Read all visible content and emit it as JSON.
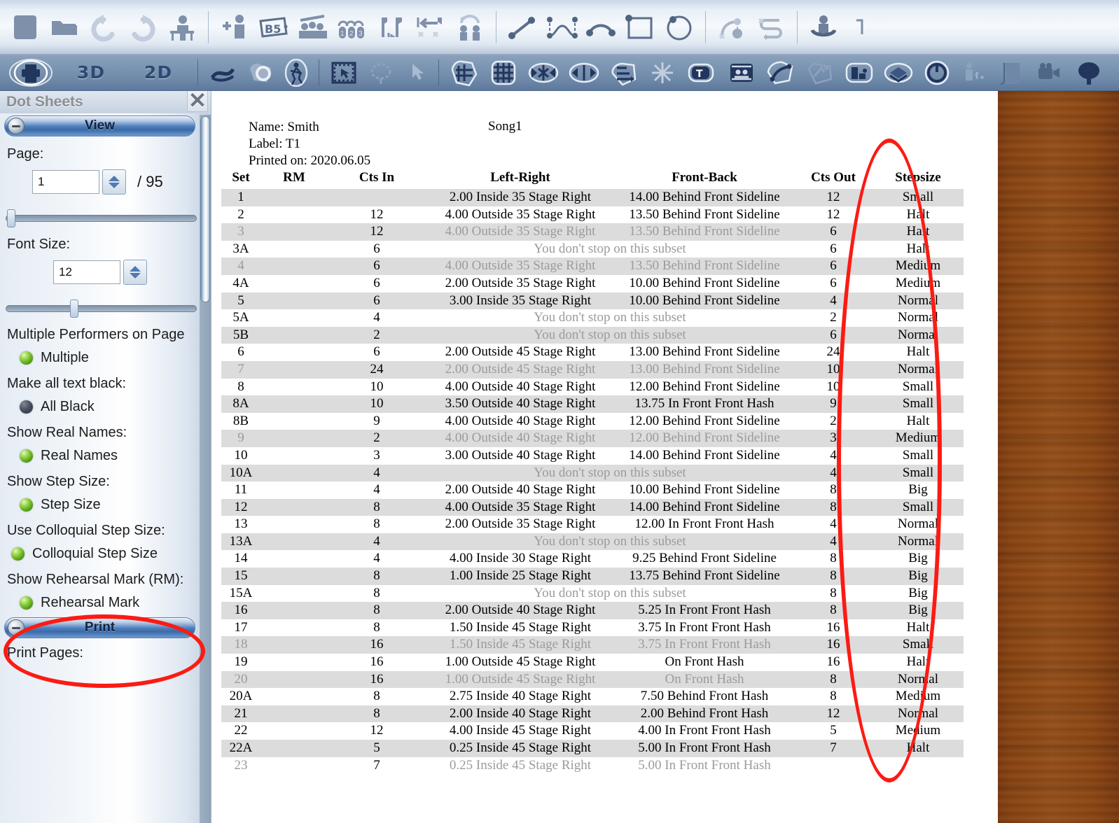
{
  "toolbar_top": {
    "buttons": [
      {
        "name": "new-file-icon",
        "label": "New"
      },
      {
        "name": "open-folder-icon",
        "label": "Open"
      },
      {
        "name": "undo-icon",
        "label": "Undo"
      },
      {
        "name": "redo-icon",
        "label": "Redo"
      },
      {
        "name": "performer-at-desk-icon",
        "label": "Performers"
      },
      {
        "name": "add-performer-icon",
        "label": "Add Performer"
      },
      {
        "name": "b5-label-icon",
        "label": "B5"
      },
      {
        "name": "group-performers-icon",
        "label": "Group"
      },
      {
        "name": "numbered-performers-icon",
        "label": "Number Performers"
      },
      {
        "name": "flags-icon",
        "label": "Flags"
      },
      {
        "name": "align-left-icon",
        "label": "Align"
      },
      {
        "name": "mirror-performers-icon",
        "label": "Mirror"
      },
      {
        "name": "line-tool-icon",
        "label": "Line"
      },
      {
        "name": "curve-points-icon",
        "label": "Curve Points"
      },
      {
        "name": "arc-tool-icon",
        "label": "Arc"
      },
      {
        "name": "rectangle-tool-icon",
        "label": "Rectangle"
      },
      {
        "name": "circle-tool-icon",
        "label": "Circle"
      },
      {
        "name": "follow-path-icon",
        "label": "Follow Path"
      },
      {
        "name": "s-path-icon",
        "label": "S Path"
      },
      {
        "name": "rotate-performer-icon",
        "label": "Rotate"
      }
    ]
  },
  "toolbar_sub": {
    "print_icon": "print-icon",
    "view_3d": "3D",
    "view_2d": "2D",
    "buttons": [
      {
        "name": "curve-draw-icon",
        "label": "Draw Curve"
      },
      {
        "name": "shape-fill-icon",
        "label": "Shape"
      },
      {
        "name": "walking-performer-icon",
        "label": "Walking"
      },
      {
        "name": "marquee-select-icon",
        "label": "Marquee Select"
      },
      {
        "name": "lasso-select-icon",
        "label": "Lasso Select"
      },
      {
        "name": "pointer-select-icon",
        "label": "Pointer"
      },
      {
        "name": "freeform-grid-icon",
        "label": "Freeform Grid"
      },
      {
        "name": "grid-icon",
        "label": "Grid"
      },
      {
        "name": "contract-horizontal-icon",
        "label": "Contract"
      },
      {
        "name": "expand-horizontal-icon",
        "label": "Expand"
      },
      {
        "name": "stagger-icon",
        "label": "Stagger"
      },
      {
        "name": "scatter-icon",
        "label": "Scatter"
      },
      {
        "name": "text-tag-icon",
        "label": "Text Tag"
      },
      {
        "name": "bleachers-icon",
        "label": "Bleachers"
      },
      {
        "name": "curved-path-icon",
        "label": "Curved Path"
      },
      {
        "name": "flip-icon",
        "label": "Flip"
      },
      {
        "name": "field-layer-icon",
        "label": "Field Layer"
      },
      {
        "name": "power-icon",
        "label": "Power"
      },
      {
        "name": "props-icon",
        "label": "Props"
      },
      {
        "name": "page-icon",
        "label": "Page"
      },
      {
        "name": "video-camera-icon",
        "label": "Video"
      },
      {
        "name": "tree-icon",
        "label": "Tree"
      }
    ]
  },
  "panel": {
    "title": "Dot Sheets",
    "close_icon": "close-icon",
    "sections": {
      "view": {
        "label": "View",
        "collapse_icon": "collapse-icon"
      },
      "print": {
        "label": "Print",
        "collapse_icon": "collapse-icon"
      }
    },
    "page": {
      "label": "Page:",
      "value": "1",
      "total": "/ 95",
      "spinner_up_icon": "spinner-up-icon",
      "spinner_down_icon": "spinner-down-icon"
    },
    "font_size": {
      "label": "Font Size:",
      "value": "12",
      "spinner_up_icon": "spinner-up-icon",
      "spinner_down_icon": "spinner-down-icon"
    },
    "options": [
      {
        "label": "Multiple Performers on Page",
        "toggle": "Multiple",
        "state": "on"
      },
      {
        "label": "Make all text black:",
        "toggle": "All Black",
        "state": "off"
      },
      {
        "label": "Show Real Names:",
        "toggle": "Real Names",
        "state": "on"
      },
      {
        "label": "Show Step Size:",
        "toggle": "Step Size",
        "state": "on"
      },
      {
        "label": "Use Colloquial Step Size:",
        "toggle": "Colloquial Step Size",
        "state": "on"
      },
      {
        "label": "Show Rehearsal Mark (RM):",
        "toggle": "Rehearsal Mark",
        "state": "on"
      }
    ],
    "print_pages_label": "Print Pages:"
  },
  "document": {
    "name_line": "Name: Smith",
    "label_line": "Label: T1",
    "printed_line": "Printed on: 2020.06.05",
    "song": "Song1",
    "columns": [
      "Set",
      "RM",
      "Cts In",
      "Left-Right",
      "Front-Back",
      "Cts Out",
      "Stepsize"
    ],
    "rows": [
      {
        "set": "1",
        "rm": "",
        "cts_in": "",
        "lr": "2.00 Inside 35 Stage Right",
        "fb": "14.00 Behind Front Sideline",
        "cts_out": "12",
        "ss": "Small",
        "alt": true,
        "dim": false
      },
      {
        "set": "2",
        "rm": "",
        "cts_in": "12",
        "lr": "4.00 Outside 35 Stage Right",
        "fb": "13.50 Behind Front Sideline",
        "cts_out": "12",
        "ss": "Halt",
        "alt": false,
        "dim": false
      },
      {
        "set": "3",
        "rm": "",
        "cts_in": "12",
        "lr": "4.00 Outside 35 Stage Right",
        "fb": "13.50 Behind Front Sideline",
        "cts_out": "6",
        "ss": "Halt",
        "alt": true,
        "dim": true
      },
      {
        "set": "3A",
        "rm": "",
        "cts_in": "6",
        "lr": "You don't stop on this subset",
        "fb": "",
        "cts_out": "6",
        "ss": "Halt",
        "alt": false,
        "dim": false,
        "subset": true
      },
      {
        "set": "4",
        "rm": "",
        "cts_in": "6",
        "lr": "4.00 Outside 35 Stage Right",
        "fb": "13.50 Behind Front Sideline",
        "cts_out": "6",
        "ss": "Medium",
        "alt": true,
        "dim": true
      },
      {
        "set": "4A",
        "rm": "",
        "cts_in": "6",
        "lr": "2.00 Outside 35 Stage Right",
        "fb": "10.00 Behind Front Sideline",
        "cts_out": "6",
        "ss": "Medium",
        "alt": false,
        "dim": false
      },
      {
        "set": "5",
        "rm": "",
        "cts_in": "6",
        "lr": "3.00 Inside 35 Stage Right",
        "fb": "10.00 Behind Front Sideline",
        "cts_out": "4",
        "ss": "Normal",
        "alt": true,
        "dim": false
      },
      {
        "set": "5A",
        "rm": "",
        "cts_in": "4",
        "lr": "You don't stop on this subset",
        "fb": "",
        "cts_out": "2",
        "ss": "Normal",
        "alt": false,
        "dim": false,
        "subset": true
      },
      {
        "set": "5B",
        "rm": "",
        "cts_in": "2",
        "lr": "You don't stop on this subset",
        "fb": "",
        "cts_out": "6",
        "ss": "Normal",
        "alt": true,
        "dim": false,
        "subset": true
      },
      {
        "set": "6",
        "rm": "",
        "cts_in": "6",
        "lr": "2.00 Outside 45 Stage Right",
        "fb": "13.00 Behind Front Sideline",
        "cts_out": "24",
        "ss": "Halt",
        "alt": false,
        "dim": false
      },
      {
        "set": "7",
        "rm": "",
        "cts_in": "24",
        "lr": "2.00 Outside 45 Stage Right",
        "fb": "13.00 Behind Front Sideline",
        "cts_out": "10",
        "ss": "Normal",
        "alt": true,
        "dim": true
      },
      {
        "set": "8",
        "rm": "",
        "cts_in": "10",
        "lr": "4.00 Outside 40 Stage Right",
        "fb": "12.00 Behind Front Sideline",
        "cts_out": "10",
        "ss": "Small",
        "alt": false,
        "dim": false
      },
      {
        "set": "8A",
        "rm": "",
        "cts_in": "10",
        "lr": "3.50 Outside 40 Stage Right",
        "fb": "13.75 In Front Front Hash",
        "cts_out": "9",
        "ss": "Small",
        "alt": true,
        "dim": false
      },
      {
        "set": "8B",
        "rm": "",
        "cts_in": "9",
        "lr": "4.00 Outside 40 Stage Right",
        "fb": "12.00 Behind Front Sideline",
        "cts_out": "2",
        "ss": "Halt",
        "alt": false,
        "dim": false
      },
      {
        "set": "9",
        "rm": "",
        "cts_in": "2",
        "lr": "4.00 Outside 40 Stage Right",
        "fb": "12.00 Behind Front Sideline",
        "cts_out": "3",
        "ss": "Medium",
        "alt": true,
        "dim": true
      },
      {
        "set": "10",
        "rm": "",
        "cts_in": "3",
        "lr": "3.00 Outside 40 Stage Right",
        "fb": "14.00 Behind Front Sideline",
        "cts_out": "4",
        "ss": "Small",
        "alt": false,
        "dim": false
      },
      {
        "set": "10A",
        "rm": "",
        "cts_in": "4",
        "lr": "You don't stop on this subset",
        "fb": "",
        "cts_out": "4",
        "ss": "Small",
        "alt": true,
        "dim": false,
        "subset": true
      },
      {
        "set": "11",
        "rm": "",
        "cts_in": "4",
        "lr": "2.00 Outside 40 Stage Right",
        "fb": "10.00 Behind Front Sideline",
        "cts_out": "8",
        "ss": "Big",
        "alt": false,
        "dim": false
      },
      {
        "set": "12",
        "rm": "",
        "cts_in": "8",
        "lr": "4.00 Outside 35 Stage Right",
        "fb": "14.00 Behind Front Sideline",
        "cts_out": "8",
        "ss": "Small",
        "alt": true,
        "dim": false
      },
      {
        "set": "13",
        "rm": "",
        "cts_in": "8",
        "lr": "2.00 Outside 35 Stage Right",
        "fb": "12.00 In Front Front Hash",
        "cts_out": "4",
        "ss": "Normal",
        "alt": false,
        "dim": false
      },
      {
        "set": "13A",
        "rm": "",
        "cts_in": "4",
        "lr": "You don't stop on this subset",
        "fb": "",
        "cts_out": "4",
        "ss": "Normal",
        "alt": true,
        "dim": false,
        "subset": true
      },
      {
        "set": "14",
        "rm": "",
        "cts_in": "4",
        "lr": "4.00 Inside 30 Stage Right",
        "fb": "9.25 Behind Front Sideline",
        "cts_out": "8",
        "ss": "Big",
        "alt": false,
        "dim": false
      },
      {
        "set": "15",
        "rm": "",
        "cts_in": "8",
        "lr": "1.00 Inside 25 Stage Right",
        "fb": "13.75 Behind Front Sideline",
        "cts_out": "8",
        "ss": "Big",
        "alt": true,
        "dim": false
      },
      {
        "set": "15A",
        "rm": "",
        "cts_in": "8",
        "lr": "You don't stop on this subset",
        "fb": "",
        "cts_out": "8",
        "ss": "Big",
        "alt": false,
        "dim": false,
        "subset": true
      },
      {
        "set": "16",
        "rm": "",
        "cts_in": "8",
        "lr": "2.00 Outside 40 Stage Right",
        "fb": "5.25 In Front Front Hash",
        "cts_out": "8",
        "ss": "Big",
        "alt": true,
        "dim": false
      },
      {
        "set": "17",
        "rm": "",
        "cts_in": "8",
        "lr": "1.50 Inside 45 Stage Right",
        "fb": "3.75 In Front Front Hash",
        "cts_out": "16",
        "ss": "Halt",
        "alt": false,
        "dim": false
      },
      {
        "set": "18",
        "rm": "",
        "cts_in": "16",
        "lr": "1.50 Inside 45 Stage Right",
        "fb": "3.75 In Front Front Hash",
        "cts_out": "16",
        "ss": "Small",
        "alt": true,
        "dim": true
      },
      {
        "set": "19",
        "rm": "",
        "cts_in": "16",
        "lr": "1.00 Outside 45 Stage Right",
        "fb": "On Front Hash",
        "cts_out": "16",
        "ss": "Halt",
        "alt": false,
        "dim": false
      },
      {
        "set": "20",
        "rm": "",
        "cts_in": "16",
        "lr": "1.00 Outside 45 Stage Right",
        "fb": "On Front Hash",
        "cts_out": "8",
        "ss": "Normal",
        "alt": true,
        "dim": true
      },
      {
        "set": "20A",
        "rm": "",
        "cts_in": "8",
        "lr": "2.75 Inside 40 Stage Right",
        "fb": "7.50 Behind Front Hash",
        "cts_out": "8",
        "ss": "Medium",
        "alt": false,
        "dim": false
      },
      {
        "set": "21",
        "rm": "",
        "cts_in": "8",
        "lr": "2.00 Inside 40 Stage Right",
        "fb": "2.00 Behind Front Hash",
        "cts_out": "12",
        "ss": "Normal",
        "alt": true,
        "dim": false
      },
      {
        "set": "22",
        "rm": "",
        "cts_in": "12",
        "lr": "4.00 Inside 45 Stage Right",
        "fb": "4.00 In Front Front Hash",
        "cts_out": "5",
        "ss": "Medium",
        "alt": false,
        "dim": false
      },
      {
        "set": "22A",
        "rm": "",
        "cts_in": "5",
        "lr": "0.25 Inside 45 Stage Right",
        "fb": "5.00 In Front Front Hash",
        "cts_out": "7",
        "ss": "Halt",
        "alt": true,
        "dim": false
      },
      {
        "set": "23",
        "rm": "",
        "cts_in": "7",
        "lr": "0.25 Inside 45 Stage Right",
        "fb": "5.00 In Front Front Hash",
        "cts_out": "",
        "ss": "",
        "alt": false,
        "dim": true
      }
    ]
  },
  "annotations": {
    "color": "#fb1b13",
    "items": [
      {
        "name": "stepsize-column-highlight",
        "shape": "ellipse"
      },
      {
        "name": "colloquial-step-size-highlight",
        "shape": "ellipse"
      }
    ]
  }
}
